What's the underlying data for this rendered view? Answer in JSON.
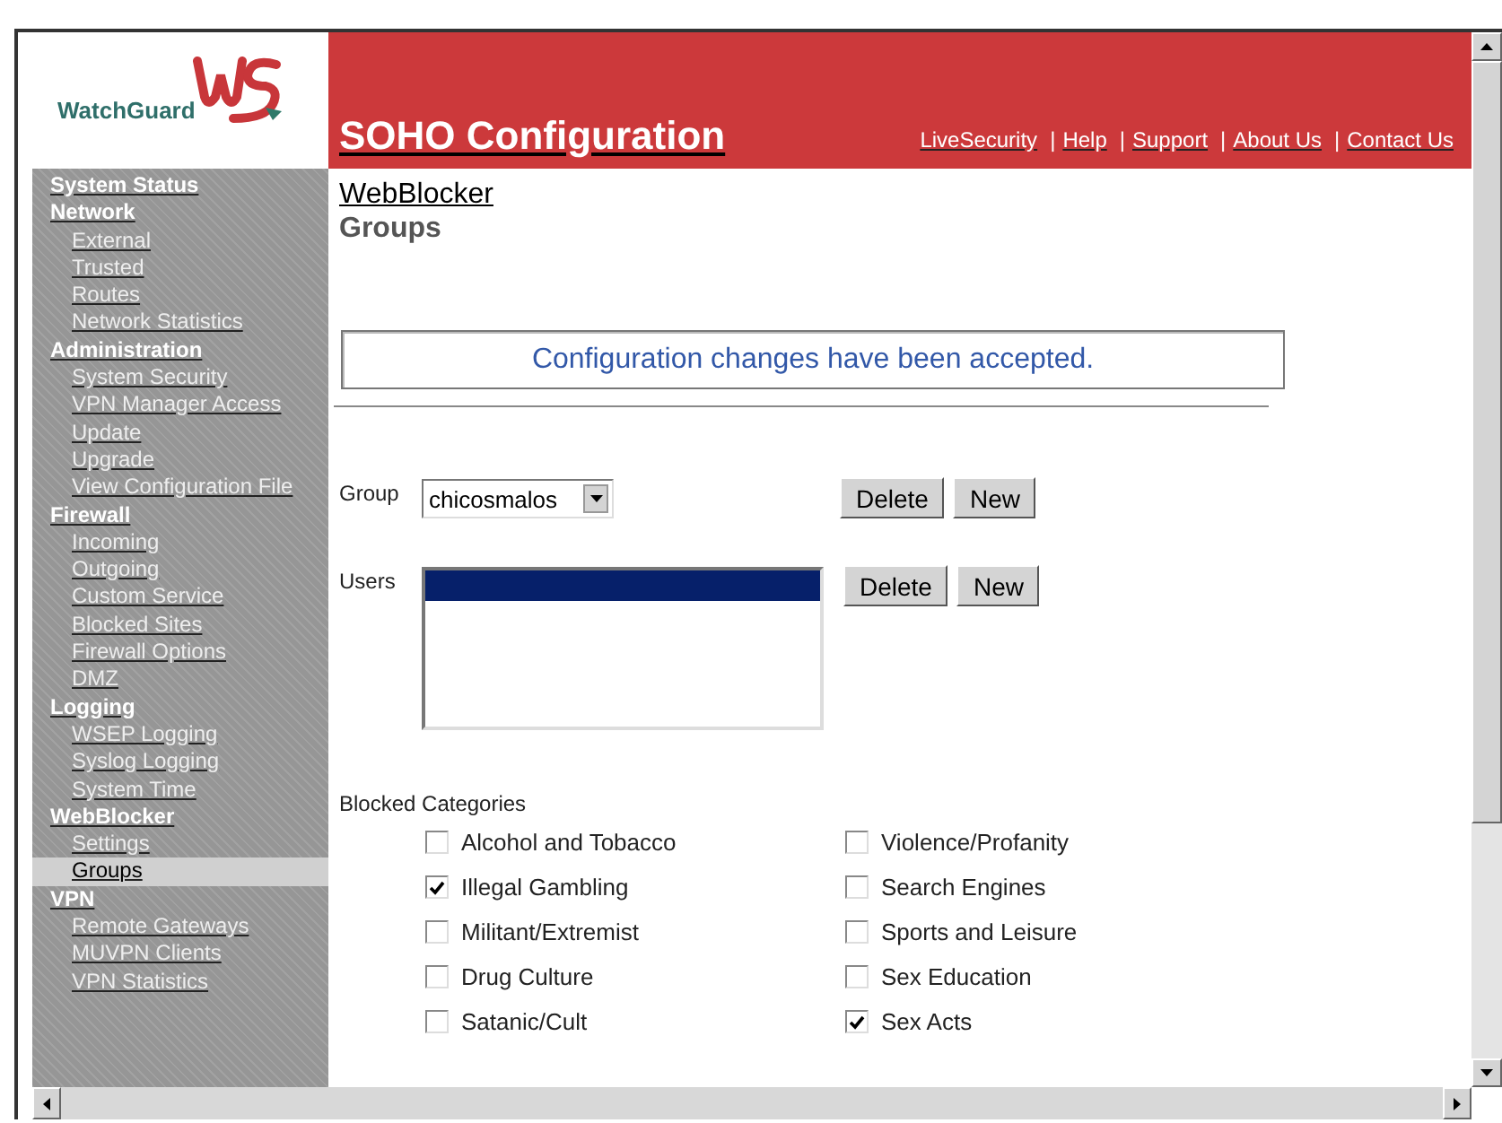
{
  "logo": {
    "text": "WatchGuard"
  },
  "header": {
    "title": "SOHO Configuration",
    "links": [
      "LiveSecurity",
      "Help",
      "Support",
      "About Us",
      "Contact Us"
    ],
    "separator": "|"
  },
  "sidebar": {
    "sections": [
      {
        "label": "System Status"
      },
      {
        "label": "Network",
        "children": [
          {
            "label": "External",
            "selected": false
          },
          {
            "label": "Trusted",
            "selected": false
          },
          {
            "label": "Routes",
            "selected": false
          },
          {
            "label": "Network Statistics",
            "selected": false
          }
        ]
      },
      {
        "label": "Administration",
        "children": [
          {
            "label": "System Security",
            "selected": false
          },
          {
            "label": "VPN Manager Access",
            "selected": false
          },
          {
            "label": "Update",
            "selected": false
          },
          {
            "label": "Upgrade",
            "selected": false
          },
          {
            "label": "View Configuration File",
            "selected": false
          }
        ]
      },
      {
        "label": "Firewall",
        "children": [
          {
            "label": "Incoming",
            "selected": false
          },
          {
            "label": "Outgoing",
            "selected": false
          },
          {
            "label": "Custom Service",
            "selected": false
          },
          {
            "label": "Blocked Sites",
            "selected": false
          },
          {
            "label": "Firewall Options",
            "selected": false
          },
          {
            "label": "DMZ",
            "selected": false
          }
        ]
      },
      {
        "label": "Logging",
        "children": [
          {
            "label": "WSEP Logging",
            "selected": false
          },
          {
            "label": "Syslog Logging",
            "selected": false
          },
          {
            "label": "System Time",
            "selected": false
          }
        ]
      },
      {
        "label": "WebBlocker",
        "children": [
          {
            "label": "Settings",
            "selected": false
          },
          {
            "label": "Groups",
            "selected": true
          }
        ]
      },
      {
        "label": "VPN",
        "children": [
          {
            "label": "Remote Gateways",
            "selected": false
          },
          {
            "label": "MUVPN Clients",
            "selected": false
          },
          {
            "label": "VPN Statistics",
            "selected": false
          }
        ]
      }
    ]
  },
  "breadcrumb": "WebBlocker",
  "page_title": "Groups",
  "message": "Configuration changes have been accepted.",
  "group": {
    "label": "Group",
    "value": "chicosmalos",
    "buttons": [
      "Delete",
      "New"
    ]
  },
  "users": {
    "label": "Users",
    "rows": [
      {
        "selected": true
      }
    ],
    "buttons": [
      "Delete",
      "New"
    ]
  },
  "blocked_categories": {
    "label": "Blocked Categories",
    "columns": [
      [
        {
          "label": "Alcohol and Tobacco",
          "checked": false
        },
        {
          "label": "Illegal Gambling",
          "checked": true
        },
        {
          "label": "Militant/Extremist",
          "checked": false
        },
        {
          "label": "Drug Culture",
          "checked": false
        },
        {
          "label": "Satanic/Cult",
          "checked": false
        }
      ],
      [
        {
          "label": "Violence/Profanity",
          "checked": false
        },
        {
          "label": "Search Engines",
          "checked": false
        },
        {
          "label": "Sports and Leisure",
          "checked": false
        },
        {
          "label": "Sex Education",
          "checked": false
        },
        {
          "label": "Sex Acts",
          "checked": true
        }
      ]
    ]
  }
}
